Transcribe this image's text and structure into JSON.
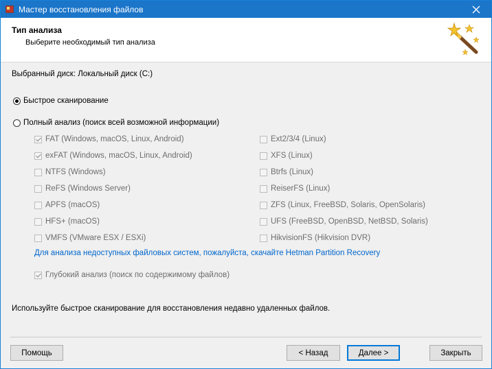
{
  "window": {
    "title": "Мастер восстановления файлов"
  },
  "header": {
    "title": "Тип анализа",
    "subtitle": "Выберите необходимый тип анализа"
  },
  "disk_label": "Выбранный диск: Локальный диск (C:)",
  "scan_options": {
    "quick": {
      "label": "Быстрое сканирование",
      "selected": true
    },
    "full": {
      "label": "Полный анализ (поиск всей возможной информации)",
      "selected": false
    }
  },
  "filesystems": {
    "left": [
      {
        "label": "FAT (Windows, macOS, Linux, Android)",
        "checked": true
      },
      {
        "label": "exFAT (Windows, macOS, Linux, Android)",
        "checked": true
      },
      {
        "label": "NTFS (Windows)",
        "checked": false
      },
      {
        "label": "ReFS (Windows Server)",
        "checked": false
      },
      {
        "label": "APFS (macOS)",
        "checked": false
      },
      {
        "label": "HFS+ (macOS)",
        "checked": false
      },
      {
        "label": "VMFS (VMware ESX / ESXi)",
        "checked": false
      }
    ],
    "right": [
      {
        "label": "Ext2/3/4 (Linux)",
        "checked": false
      },
      {
        "label": "XFS (Linux)",
        "checked": false
      },
      {
        "label": "Btrfs (Linux)",
        "checked": false
      },
      {
        "label": "ReiserFS (Linux)",
        "checked": false
      },
      {
        "label": "ZFS (Linux, FreeBSD, Solaris, OpenSolaris)",
        "checked": false
      },
      {
        "label": "UFS (FreeBSD, OpenBSD, NetBSD, Solaris)",
        "checked": false
      },
      {
        "label": "HikvisionFS (Hikvision DVR)",
        "checked": false
      }
    ]
  },
  "partition_link": "Для анализа недоступных файловых систем, пожалуйста, скачайте Hetman Partition Recovery",
  "deep_analysis": {
    "label": "Глубокий анализ (поиск по содержимому файлов)",
    "checked": true
  },
  "hint": "Используйте быстрое сканирование для восстановления недавно удаленных файлов.",
  "buttons": {
    "help": "Помощь",
    "back": "< Назад",
    "next": "Далее >",
    "close": "Закрыть"
  },
  "colors": {
    "titlebar": "#1b75c9",
    "link": "#0066cc",
    "accent": "#0078d7"
  }
}
